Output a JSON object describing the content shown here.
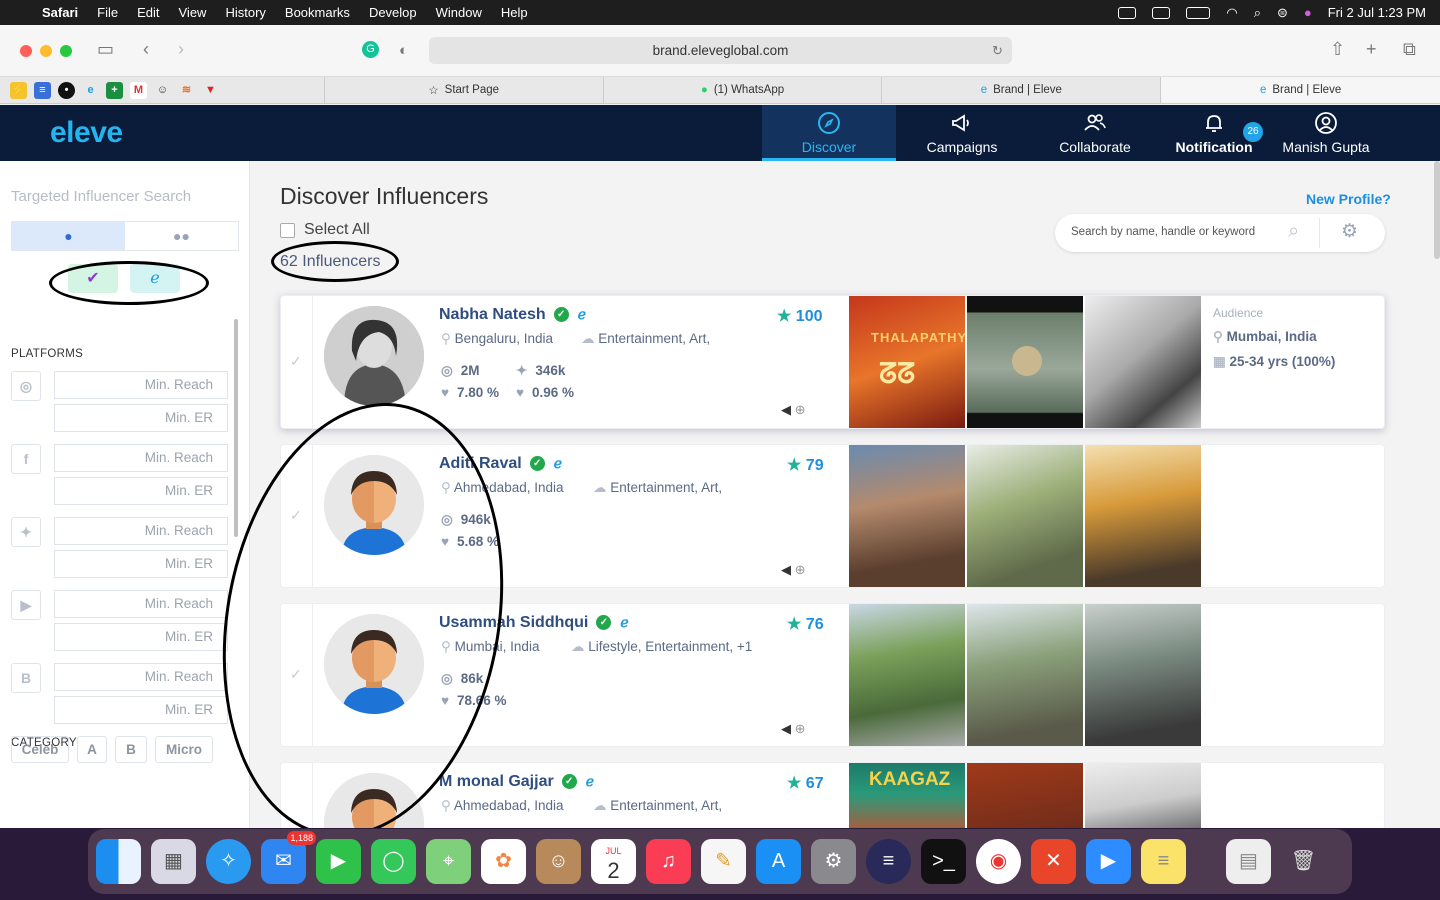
{
  "menubar": {
    "app": "Safari",
    "items": [
      "File",
      "Edit",
      "View",
      "History",
      "Bookmarks",
      "Develop",
      "Window",
      "Help"
    ],
    "clock": "Fri 2 Jul  1:23 PM"
  },
  "browser": {
    "url": "brand.eleveglobal.com",
    "tabs": [
      "Start Page",
      "(1) WhatsApp",
      "Brand | Eleve",
      "Brand | Eleve"
    ]
  },
  "nav": {
    "logo": "eleve",
    "items": [
      {
        "label": "Discover",
        "icon": "compass-icon"
      },
      {
        "label": "Campaigns",
        "icon": "megaphone-icon"
      },
      {
        "label": "Collaborate",
        "icon": "users-icon"
      },
      {
        "label": "Notification",
        "icon": "bell-icon"
      },
      {
        "label": "Manish Gupta",
        "icon": "user-circle-icon"
      }
    ],
    "notification_count": "26"
  },
  "sidebar": {
    "title": "Targeted Influencer Search",
    "platforms_heading": "PLATFORMS",
    "min_reach": "Min. Reach",
    "min_er": "Min. ER",
    "category_heading": "CATEGORY",
    "categories": [
      "Celeb",
      "A",
      "B",
      "Micro"
    ]
  },
  "main": {
    "title": "Discover Influencers",
    "new_profile": "New Profile?",
    "select_all": "Select All",
    "count": "62 Influencers",
    "search_placeholder": "Search by name, handle or keyword"
  },
  "influencers": [
    {
      "name": "Nabha Natesh",
      "score": "100",
      "location": "Bengaluru, India",
      "categories": "Entertainment, Art,",
      "ig": "2M",
      "tw": "346k",
      "ig_er": "7.80 %",
      "tw_er": "0.96 %",
      "audience_label": "Audience",
      "audience_location": "Mumbai, India",
      "audience_age": "25-34 yrs (100%)"
    },
    {
      "name": "Aditi Raval",
      "score": "79",
      "location": "Ahmedabad, India",
      "categories": "Entertainment, Art,",
      "ig": "946k",
      "ig_er": "5.68 %"
    },
    {
      "name": "Usammah Siddhqui",
      "score": "76",
      "location": "Mumbai, India",
      "categories": "Lifestyle, Entertainment, +1",
      "ig": "86k",
      "ig_er": "78.66 %"
    },
    {
      "name": "M monal Gajjar",
      "score": "67",
      "location": "Ahmedabad, India",
      "categories": "Entertainment, Art,"
    }
  ],
  "photo_texts": {
    "poster1": "THALAPATHY",
    "poster2": "KAAGAZ"
  },
  "dock": {
    "mail_badge": "1,188",
    "cal_month": "JUL",
    "cal_day": "2"
  },
  "colors": {
    "nav_bg": "#0b1c3b",
    "accent": "#24b4f0",
    "verified": "#20a84a"
  }
}
